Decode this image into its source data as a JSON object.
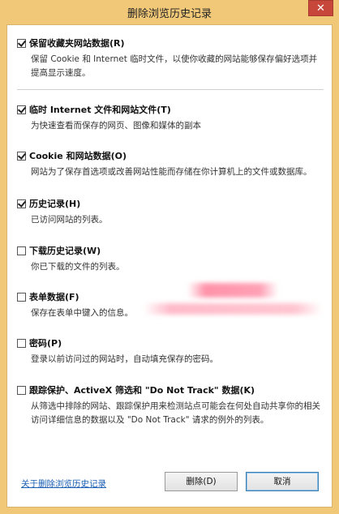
{
  "window": {
    "title": "删除浏览历史记录",
    "close_glyph": "✕"
  },
  "options": [
    {
      "label": "保留收藏夹网站数据(R)",
      "checked": true,
      "desc": "保留 Cookie 和 Internet 临时文件，以使你收藏的网站能够保存偏好选项并提高显示速度。"
    },
    {
      "label": "临时 Internet 文件和网站文件(T)",
      "checked": true,
      "desc": "为快速查看而保存的网页、图像和媒体的副本"
    },
    {
      "label": "Cookie 和网站数据(O)",
      "checked": true,
      "desc": "网站为了保存首选项或改善网站性能而存储在你计算机上的文件或数据库。"
    },
    {
      "label": "历史记录(H)",
      "checked": true,
      "desc": "已访问网站的列表。"
    },
    {
      "label": "下载历史记录(W)",
      "checked": false,
      "desc": "你已下载的文件的列表。"
    },
    {
      "label": "表单数据(F)",
      "checked": false,
      "desc": "保存在表单中键入的信息。"
    },
    {
      "label": "密码(P)",
      "checked": false,
      "desc": "登录以前访问过的网站时，自动填充保存的密码。"
    },
    {
      "label": "跟踪保护、ActiveX 筛选和 \"Do Not Track\" 数据(K)",
      "checked": false,
      "desc": "从筛选中排除的网站、跟踪保护用来检测站点可能会在何处自动共享你的相关访问详细信息的数据以及 \"Do Not Track\" 请求的例外的列表。"
    }
  ],
  "footer": {
    "link_label": "关于删除浏览历史记录",
    "delete_label": "删除(D)",
    "cancel_label": "取消"
  },
  "colors": {
    "frame": "#f0c878",
    "close_button": "#c7473a",
    "link": "#1a5fb4"
  }
}
